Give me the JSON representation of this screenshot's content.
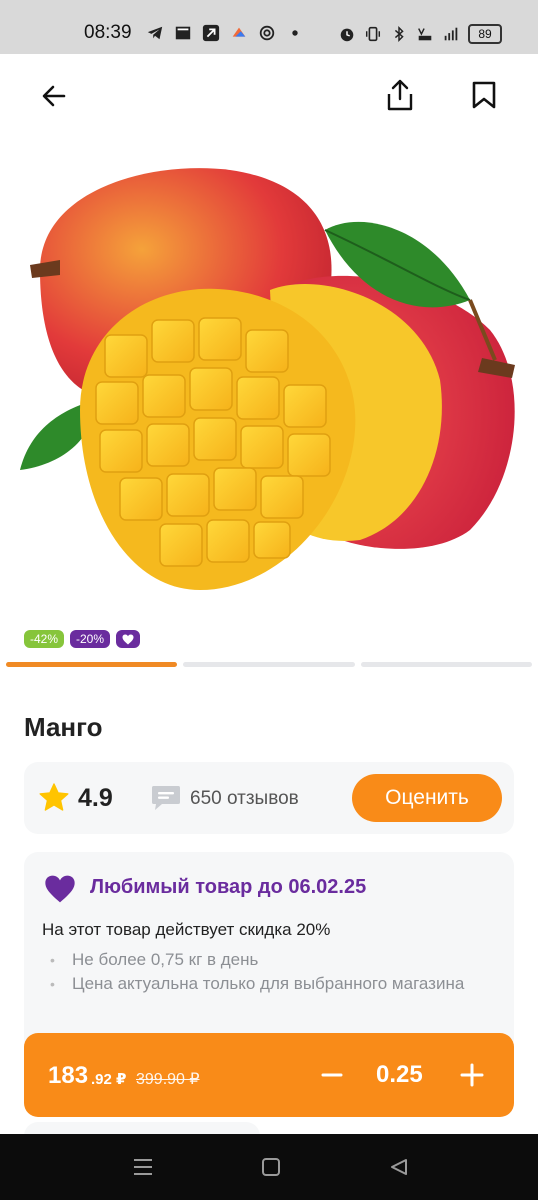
{
  "status_bar": {
    "time": "08:39",
    "battery": "89",
    "left_icons": [
      "telegram-icon",
      "news-icon",
      "arrow-app-icon",
      "cloud-app-icon",
      "spiral-app-icon",
      "dot-icon"
    ],
    "right_icons": [
      "alarm-icon",
      "vibrate-icon",
      "bluetooth-icon",
      "volte-icon",
      "signal-4g-icon",
      "battery-icon"
    ]
  },
  "nav": {
    "back": "back-arrow-icon",
    "share": "share-icon",
    "bookmark": "bookmark-icon"
  },
  "badges": [
    {
      "text": "-42%",
      "color": "#86c53b"
    },
    {
      "text": "-20%",
      "color": "#6a2c9e"
    },
    {
      "icon": "heart-icon",
      "color": "#6a2c9e"
    }
  ],
  "carousel": {
    "pages": 3,
    "active": 1
  },
  "product": {
    "title": "Манго"
  },
  "rating": {
    "value": "4.9",
    "reviews": "650 отзывов",
    "rate_button": "Оценить"
  },
  "promo": {
    "title": "Любимый товар до 06.02.25",
    "description": "На этот товар действует скидка 20%",
    "bullets": [
      "Не более 0,75 кг в день",
      "Цена актуальна только для выбранного магазина"
    ]
  },
  "cart": {
    "price_main": "183",
    "price_fraction": ".92 ₽",
    "price_old": "399.90 ₽",
    "quantity": "0.25"
  },
  "colors": {
    "accent": "#f98b18",
    "purple": "#6a2c9e",
    "green": "#86c53b"
  }
}
